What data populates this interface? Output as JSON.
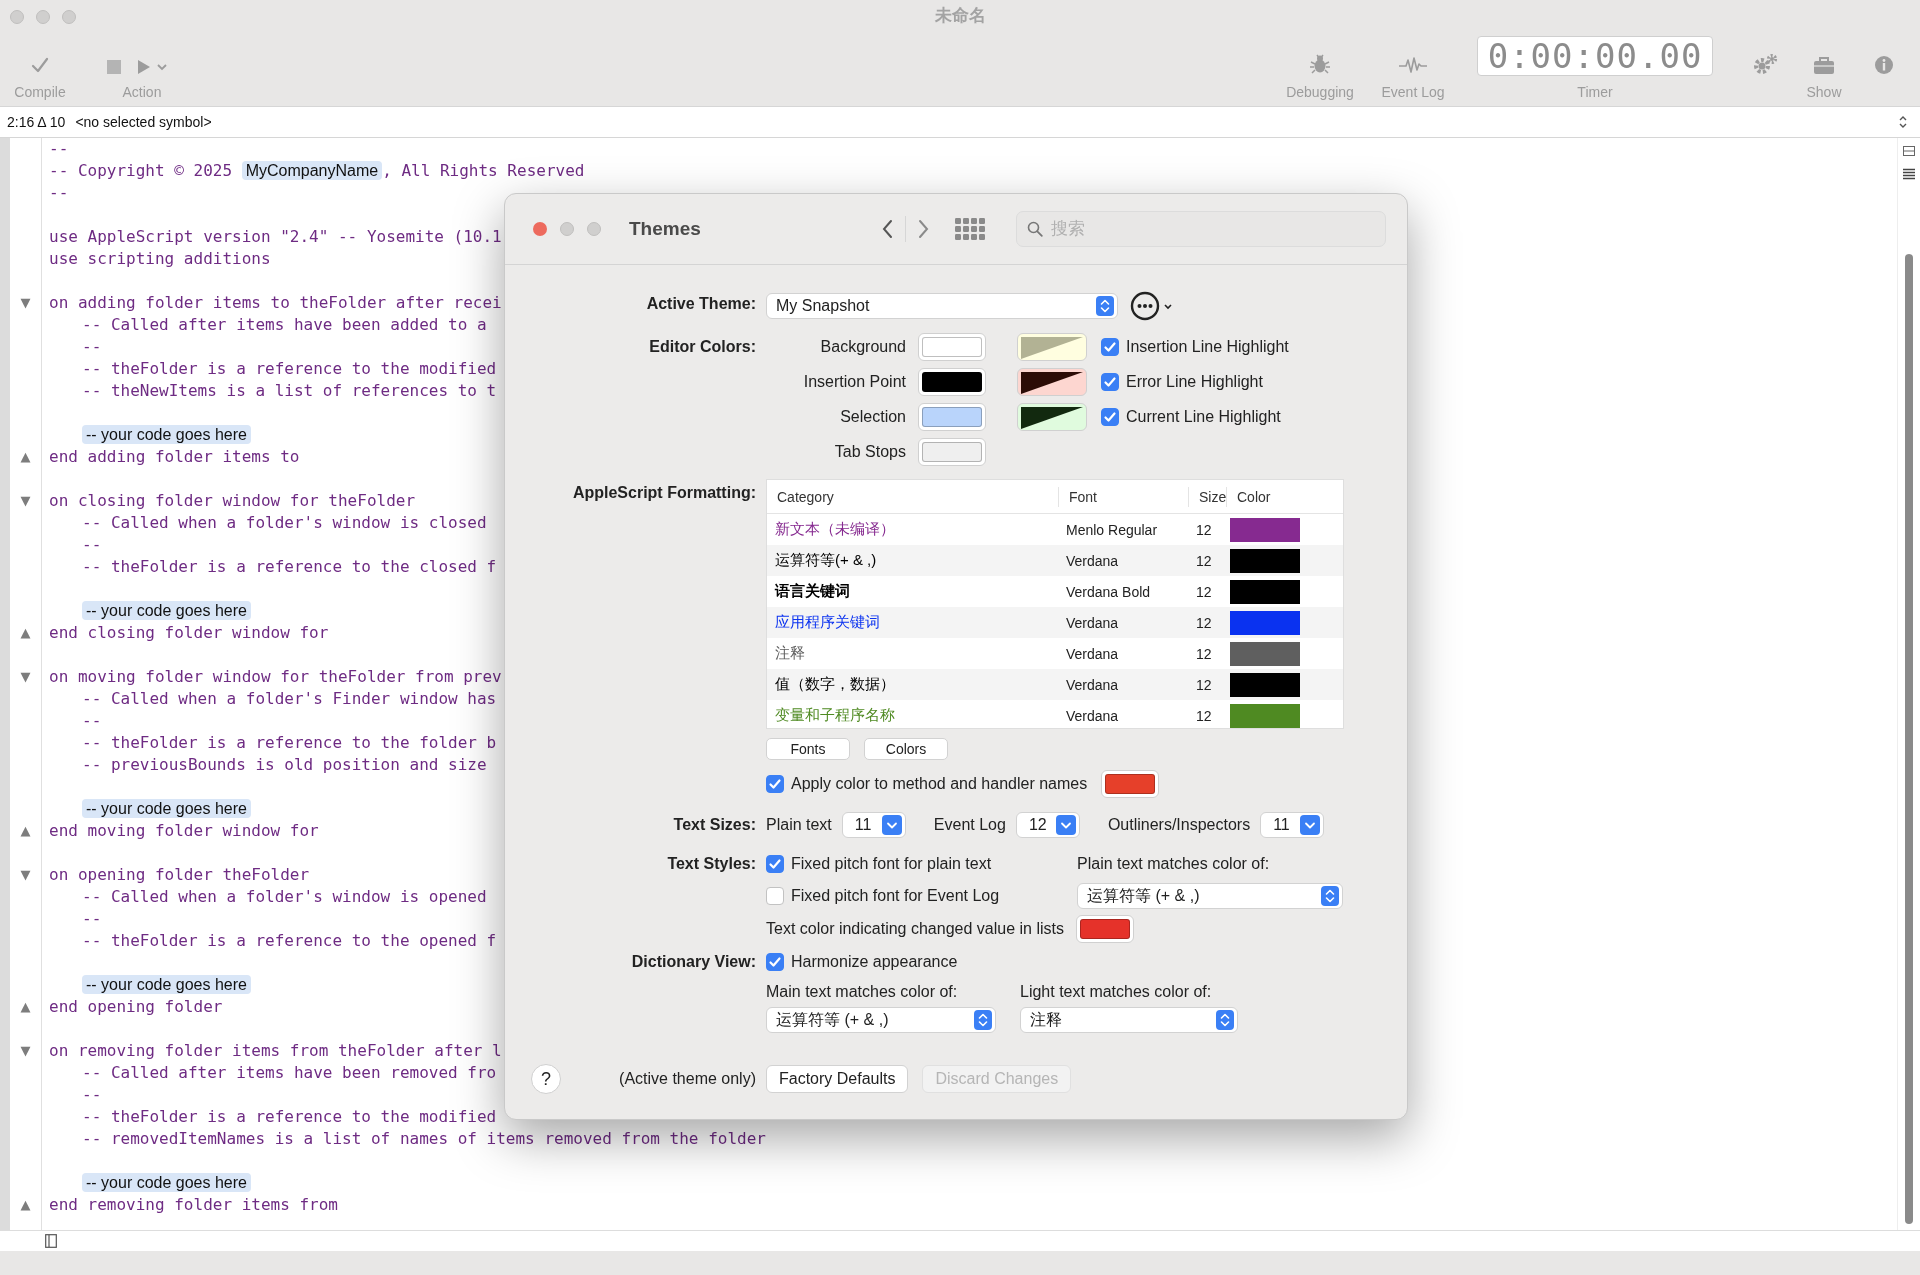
{
  "window": {
    "title": "未命名"
  },
  "toolbar": {
    "left": [
      {
        "kind": "compile",
        "label": "Compile"
      },
      {
        "kind": "action",
        "label": "Action"
      }
    ],
    "right": [
      {
        "kind": "debugging",
        "label": "Debugging"
      },
      {
        "kind": "event_log",
        "label": "Event Log"
      },
      {
        "kind": "timer",
        "label": "Timer",
        "display": "0:00:00.00"
      },
      {
        "kind": "settings"
      },
      {
        "kind": "show",
        "label": "Show"
      },
      {
        "kind": "info"
      }
    ]
  },
  "navigation": {
    "position": "2:16 Δ 10",
    "symbol": "<no selected symbol>"
  },
  "editor": {
    "lines": [
      {
        "kind": "code",
        "text": "--"
      },
      {
        "kind": "code",
        "text": "-- Copyright © 2025 ",
        "placeholder": "MyCompanyName",
        "after": ", All Rights Reserved"
      },
      {
        "kind": "code",
        "text": "--"
      },
      {
        "kind": "blank"
      },
      {
        "kind": "code",
        "text": "use AppleScript version \"2.4\" -- Yosemite (10.1"
      },
      {
        "kind": "code",
        "text": "use scripting additions"
      },
      {
        "kind": "blank"
      },
      {
        "kind": "code",
        "fold": "▼",
        "text": "on adding folder items to theFolder after recei"
      },
      {
        "kind": "code",
        "text": "\t-- Called after items have been added to a"
      },
      {
        "kind": "code",
        "text": "\t--"
      },
      {
        "kind": "code",
        "text": "\t-- theFolder is a reference to the modified"
      },
      {
        "kind": "code",
        "text": "\t-- theNewItems is a list of references to t"
      },
      {
        "kind": "blank"
      },
      {
        "kind": "placeholder",
        "placeholder": "-- your code goes here"
      },
      {
        "kind": "code",
        "fold": "▲",
        "text": "end adding folder items to"
      },
      {
        "kind": "blank"
      },
      {
        "kind": "code",
        "fold": "▼",
        "text": "on closing folder window for theFolder"
      },
      {
        "kind": "code",
        "text": "\t-- Called when a folder's window is closed"
      },
      {
        "kind": "code",
        "text": "\t--"
      },
      {
        "kind": "code",
        "text": "\t-- theFolder is a reference to the closed f"
      },
      {
        "kind": "blank"
      },
      {
        "kind": "placeholder",
        "placeholder": "-- your code goes here"
      },
      {
        "kind": "code",
        "fold": "▲",
        "text": "end closing folder window for"
      },
      {
        "kind": "blank"
      },
      {
        "kind": "code",
        "fold": "▼",
        "text": "on moving folder window for theFolder from prev"
      },
      {
        "kind": "code",
        "text": "\t-- Called when a folder's Finder window has"
      },
      {
        "kind": "code",
        "text": "\t--"
      },
      {
        "kind": "code",
        "text": "\t-- theFolder is a reference to the folder b"
      },
      {
        "kind": "code",
        "text": "\t-- previousBounds is old position and size"
      },
      {
        "kind": "blank"
      },
      {
        "kind": "placeholder",
        "placeholder": "-- your code goes here"
      },
      {
        "kind": "code",
        "fold": "▲",
        "text": "end moving folder window for"
      },
      {
        "kind": "blank"
      },
      {
        "kind": "code",
        "fold": "▼",
        "text": "on opening folder theFolder"
      },
      {
        "kind": "code",
        "text": "\t-- Called when a folder's window is opened"
      },
      {
        "kind": "code",
        "text": "\t--"
      },
      {
        "kind": "code",
        "text": "\t-- theFolder is a reference to the opened f"
      },
      {
        "kind": "blank"
      },
      {
        "kind": "placeholder",
        "placeholder": "-- your code goes here"
      },
      {
        "kind": "code",
        "fold": "▲",
        "text": "end opening folder"
      },
      {
        "kind": "blank"
      },
      {
        "kind": "code",
        "fold": "▼",
        "text": "on removing folder items from theFolder after l"
      },
      {
        "kind": "code",
        "text": "\t-- Called after items have been removed fro"
      },
      {
        "kind": "code",
        "text": "\t--"
      },
      {
        "kind": "code",
        "text": "\t-- theFolder is a reference to the modified"
      },
      {
        "kind": "code",
        "text": "\t-- removedItemNames is a list of names of items removed from the folder"
      },
      {
        "kind": "blank"
      },
      {
        "kind": "placeholder",
        "placeholder": "-- your code goes here"
      },
      {
        "kind": "code",
        "fold": "▲",
        "text": "end removing folder items from"
      }
    ]
  },
  "themes_dialog": {
    "title": "Themes",
    "search": {
      "placeholder": "搜索"
    },
    "active_theme": {
      "label": "Active Theme:",
      "value": "My Snapshot"
    },
    "editor_colors": {
      "label": "Editor Colors:",
      "wells": [
        {
          "label": "Background",
          "color": "#ffffff"
        },
        {
          "label": "Insertion Point",
          "color": "#000000"
        },
        {
          "label": "Selection",
          "color": "#b9d4fb"
        },
        {
          "label": "Tab Stops",
          "color": "#efefef"
        }
      ],
      "highlights": [
        {
          "label": "Insertion Line Highlight",
          "checked": true,
          "halves": [
            {
              "color": "#b2b294"
            },
            {
              "color": "#fffee0"
            }
          ]
        },
        {
          "label": "Error Line Highlight",
          "checked": true,
          "halves": [
            {
              "color": "#2c0c06"
            },
            {
              "color": "#fdd6d0"
            }
          ]
        },
        {
          "label": "Current Line Highlight",
          "checked": true,
          "halves": [
            {
              "color": "#12290f"
            },
            {
              "color": "#e0fbde"
            }
          ]
        }
      ]
    },
    "formatting": {
      "label": "AppleScript Formatting:",
      "columns": [
        "Category",
        "Font",
        "Size",
        "Color"
      ],
      "rows": [
        {
          "category": "新文本（未编译）",
          "font": "Menlo Regular",
          "size": "12",
          "color": "#862a90",
          "bold": false
        },
        {
          "category": "运算符等(+ & ,)",
          "font": "Verdana",
          "size": "12",
          "color": "#000000",
          "bold": false
        },
        {
          "category": "语言关键词",
          "font": "Verdana Bold",
          "size": "12",
          "color": "#000000",
          "bold": true
        },
        {
          "category": "应用程序关键词",
          "font": "Verdana",
          "size": "12",
          "color": "#0a32f0",
          "bold": false
        },
        {
          "category": "注释",
          "font": "Verdana",
          "size": "12",
          "color": "#5f5f5f",
          "bold": false
        },
        {
          "category": "值（数字，数据）",
          "font": "Verdana",
          "size": "12",
          "color": "#000000",
          "bold": false
        },
        {
          "category": "变量和子程序名称",
          "font": "Verdana",
          "size": "12",
          "color": "#4f8a22",
          "bold": false
        }
      ],
      "buttons": [
        "Fonts",
        "Colors"
      ],
      "apply_color": {
        "label": "Apply color to method and handler names",
        "checked": true,
        "color": "#e6402a"
      }
    },
    "text_sizes": {
      "label": "Text Sizes:",
      "items": [
        {
          "label": "Plain text",
          "value": "11"
        },
        {
          "label": "Event Log",
          "value": "12"
        },
        {
          "label": "Outliners/Inspectors",
          "value": "11"
        }
      ]
    },
    "text_styles": {
      "label": "Text Styles:",
      "checkboxes": [
        {
          "label": "Fixed pitch font for plain text",
          "checked": true
        },
        {
          "label": "Fixed pitch font for Event Log",
          "checked": false
        }
      ],
      "plain_match": {
        "label": "Plain text matches color of:",
        "value": "运算符等 (+ & ,)"
      },
      "changed_color": {
        "label": "Text color indicating changed value in lists",
        "color": "#e5322a"
      }
    },
    "dictionary_view": {
      "label": "Dictionary View:",
      "harmonize": {
        "label": "Harmonize appearance",
        "checked": true
      },
      "main_match": {
        "label": "Main text matches color of:",
        "value": "运算符等 (+ & ,)"
      },
      "light_match": {
        "label": "Light text matches color of:",
        "value": "注释"
      }
    },
    "footer": {
      "help": "?",
      "note": "(Active theme only)",
      "buttons": [
        {
          "label": "Factory Defaults",
          "disabled": false
        },
        {
          "label": "Discard Changes",
          "disabled": true
        }
      ]
    }
  }
}
